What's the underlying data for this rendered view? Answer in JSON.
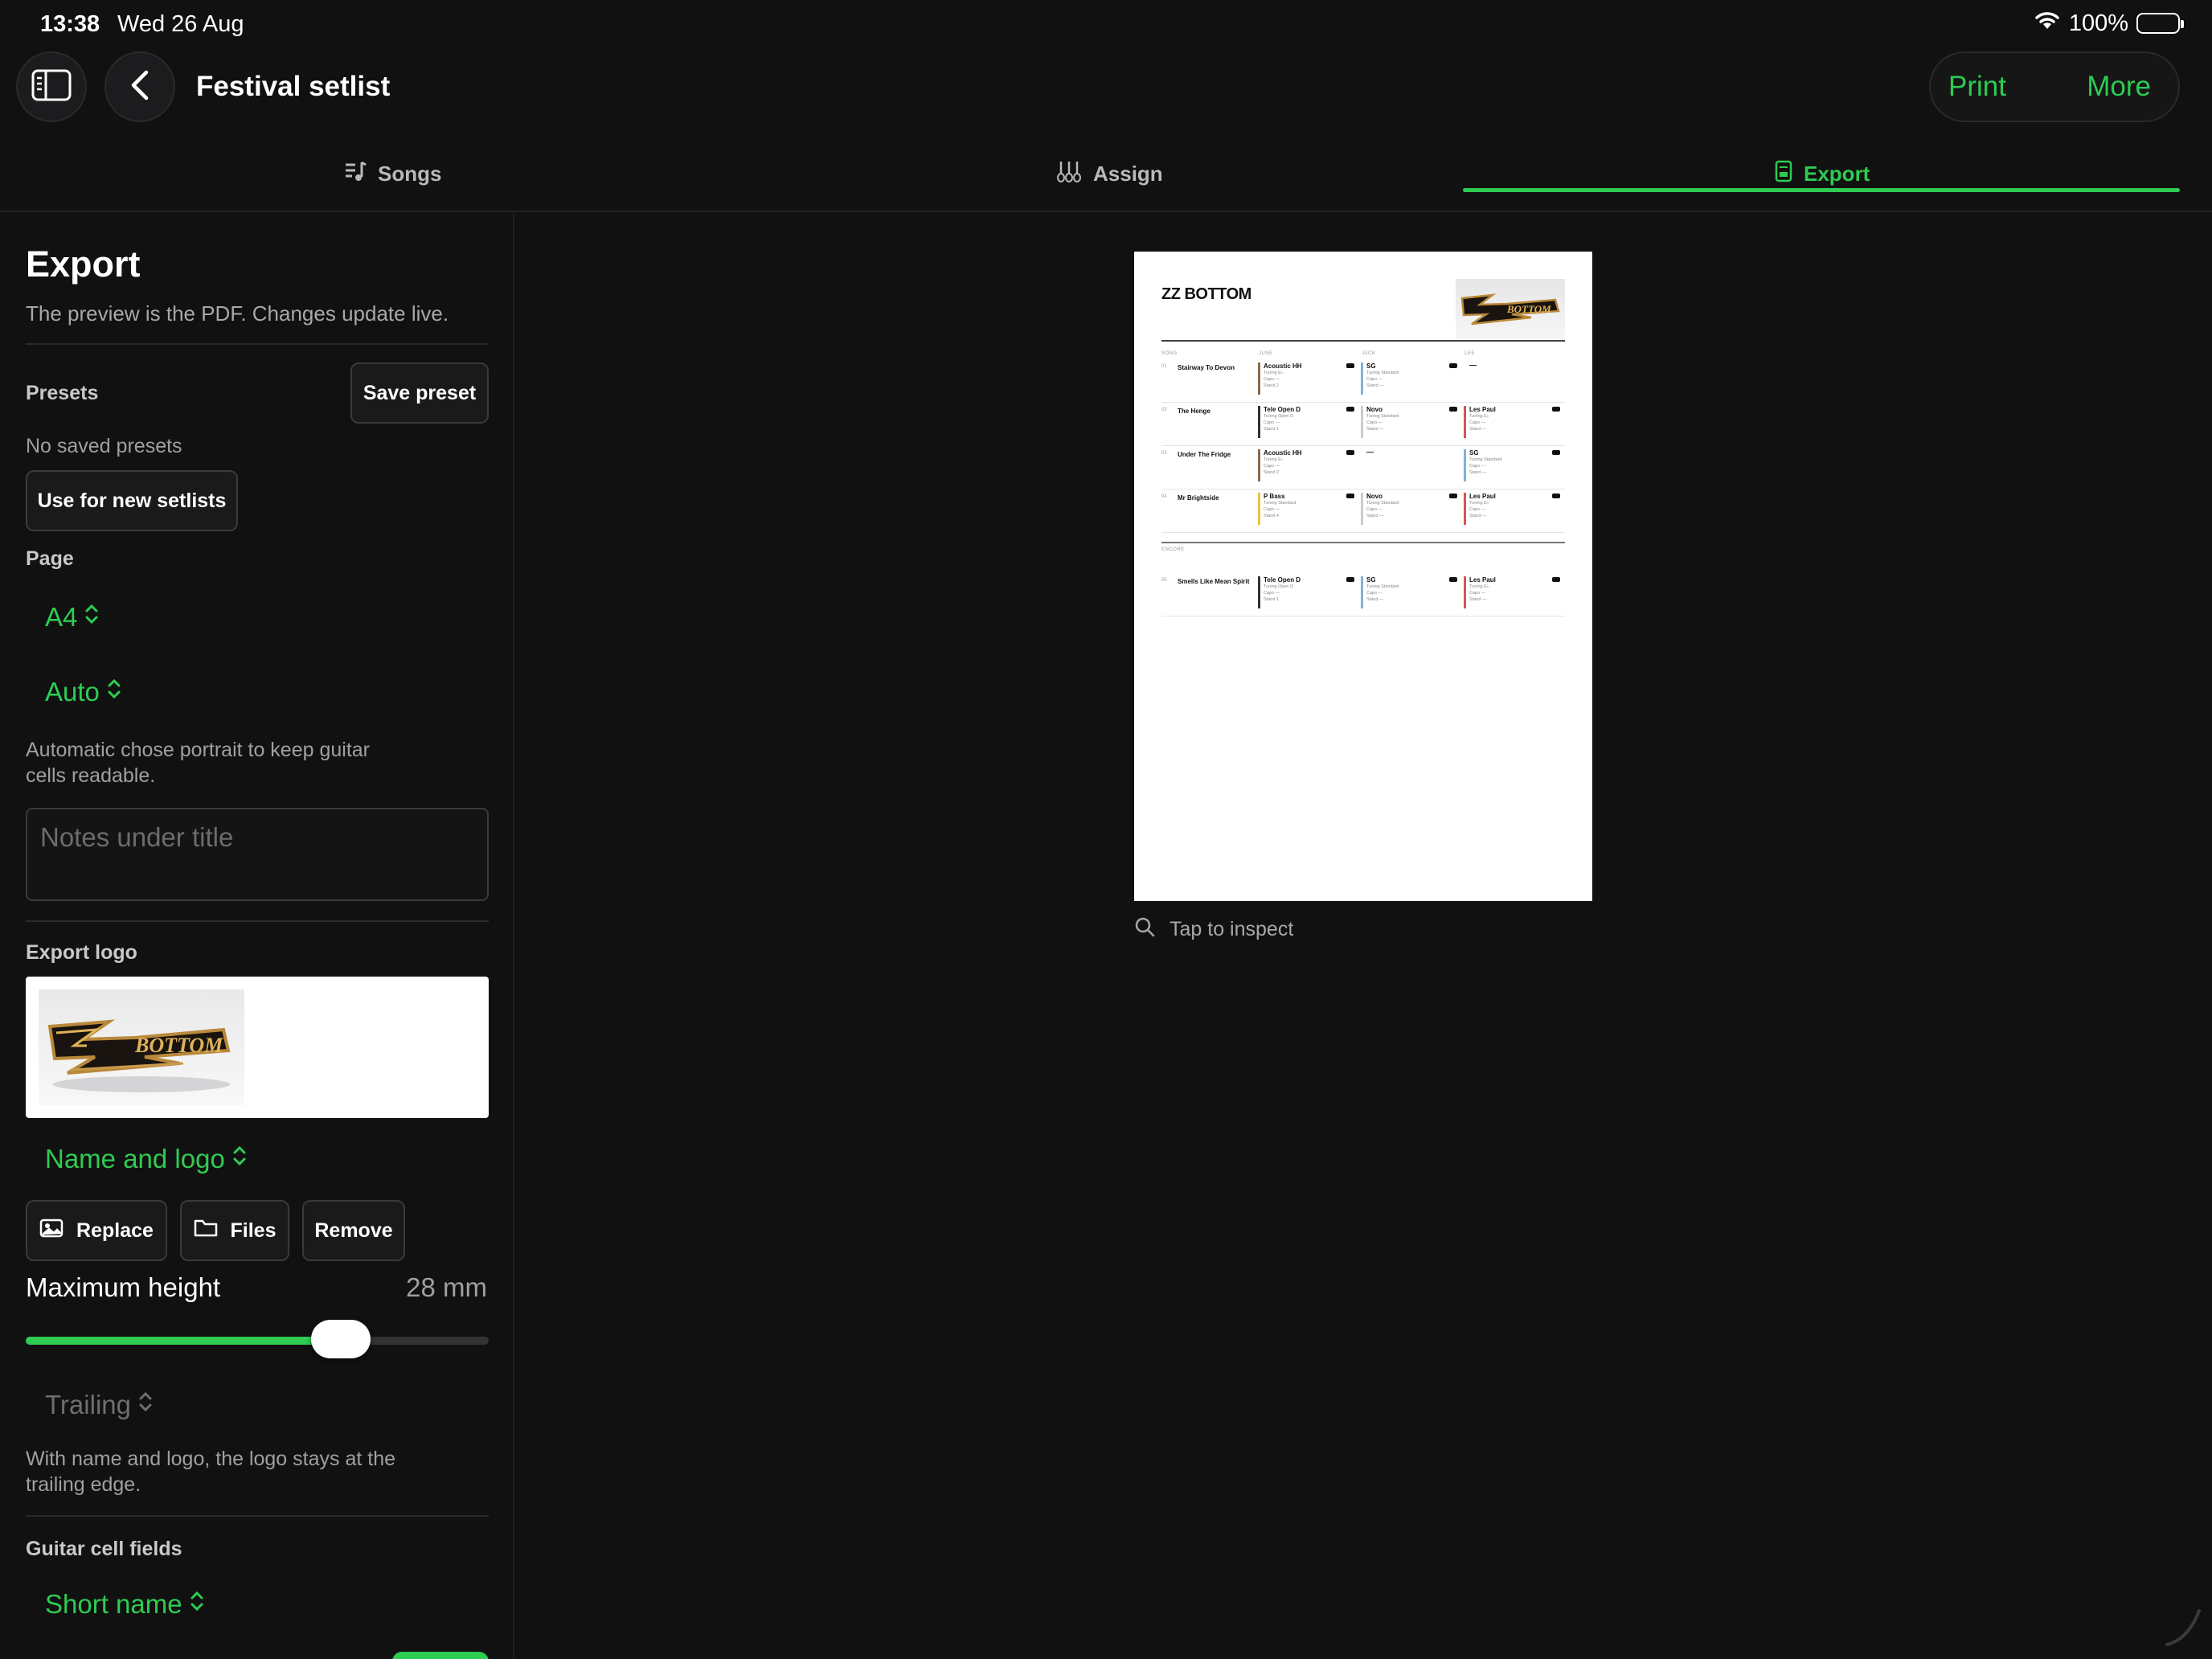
{
  "status": {
    "time": "13:38",
    "date": "Wed 26 Aug",
    "battery": "100%"
  },
  "nav": {
    "title": "Festival setlist",
    "print": "Print",
    "more": "More"
  },
  "tabs": [
    {
      "label": "Songs",
      "icon": "music-list-icon"
    },
    {
      "label": "Assign",
      "icon": "guitars-icon"
    },
    {
      "label": "Export",
      "icon": "pdf-document-icon",
      "active": true
    }
  ],
  "sidebar": {
    "heading": "Export",
    "subtitle": "The preview is the PDF. Changes update live.",
    "presets_label": "Presets",
    "save_preset": "Save preset",
    "no_presets": "No saved presets",
    "use_for_new": "Use for new setlists",
    "page_label": "Page",
    "paper_size": "A4",
    "orientation": "Auto",
    "orientation_hint": "Automatic chose portrait to keep guitar cells readable.",
    "notes_placeholder": "Notes under title",
    "export_logo_label": "Export logo",
    "logo_mode": "Name and logo",
    "replace": "Replace",
    "files": "Files",
    "remove": "Remove",
    "max_height_label": "Maximum height",
    "max_height_value": "28 mm",
    "max_height_fraction": 0.68,
    "alignment": "Trailing",
    "alignment_hint": "With name and logo, the logo stays at the trailing edge.",
    "guitar_fields_label": "Guitar cell fields",
    "guitar_field_mode": "Short name"
  },
  "preview": {
    "band": "ZZ BOTTOM",
    "columns": [
      "SONG",
      "JUNE",
      "JACK",
      "LEE"
    ],
    "encore_label": "ENCORE",
    "rows": [
      {
        "num": "01",
        "song": "Stairway To Devon",
        "cells": [
          {
            "name": "Acoustic HH",
            "color": "#8a6a4a",
            "meta": [
              "Tuning E♭",
              "Capo —",
              "Stand 2"
            ]
          },
          {
            "name": "SG",
            "color": "#7fb3d8",
            "meta": [
              "Tuning Standard",
              "Capo —",
              "Stand —"
            ]
          },
          {
            "name": "—",
            "color": "",
            "meta": []
          }
        ]
      },
      {
        "num": "02",
        "song": "The Henge",
        "cells": [
          {
            "name": "Tele Open D",
            "color": "#333333",
            "meta": [
              "Tuning Open D",
              "Capo —",
              "Stand 1"
            ]
          },
          {
            "name": "Novo",
            "color": "#cccccc",
            "meta": [
              "Tuning Standard",
              "Capo —",
              "Stand —"
            ]
          },
          {
            "name": "Les Paul",
            "color": "#d9534f",
            "meta": [
              "Tuning E♭",
              "Capo —",
              "Stand —"
            ]
          }
        ]
      },
      {
        "num": "03",
        "song": "Under The Fridge",
        "cells": [
          {
            "name": "Acoustic HH",
            "color": "#8a6a4a",
            "meta": [
              "Tuning E♭",
              "Capo —",
              "Stand 2"
            ]
          },
          {
            "name": "—",
            "color": "",
            "meta": []
          },
          {
            "name": "SG",
            "color": "#7fb3d8",
            "meta": [
              "Tuning Standard",
              "Capo —",
              "Stand —"
            ]
          }
        ]
      },
      {
        "num": "04",
        "song": "Mr Brightside",
        "cells": [
          {
            "name": "P Bass",
            "color": "#f0c040",
            "meta": [
              "Tuning Standard",
              "Capo —",
              "Stand 4"
            ]
          },
          {
            "name": "Novo",
            "color": "#cccccc",
            "meta": [
              "Tuning Standard",
              "Capo —",
              "Stand —"
            ]
          },
          {
            "name": "Les Paul",
            "color": "#d9534f",
            "meta": [
              "Tuning E♭",
              "Capo —",
              "Stand —"
            ]
          }
        ]
      },
      {
        "num": "05",
        "song": "Smells Like Mean Spirit",
        "encore": true,
        "cells": [
          {
            "name": "Tele Open D",
            "color": "#333333",
            "meta": [
              "Tuning Open D",
              "Capo —",
              "Stand 1"
            ]
          },
          {
            "name": "SG",
            "color": "#7fb3d8",
            "meta": [
              "Tuning Standard",
              "Capo —",
              "Stand —"
            ]
          },
          {
            "name": "Les Paul",
            "color": "#d9534f",
            "meta": [
              "Tuning E♭",
              "Capo —",
              "Stand —"
            ]
          }
        ]
      }
    ],
    "inspect_label": "Tap to inspect"
  }
}
